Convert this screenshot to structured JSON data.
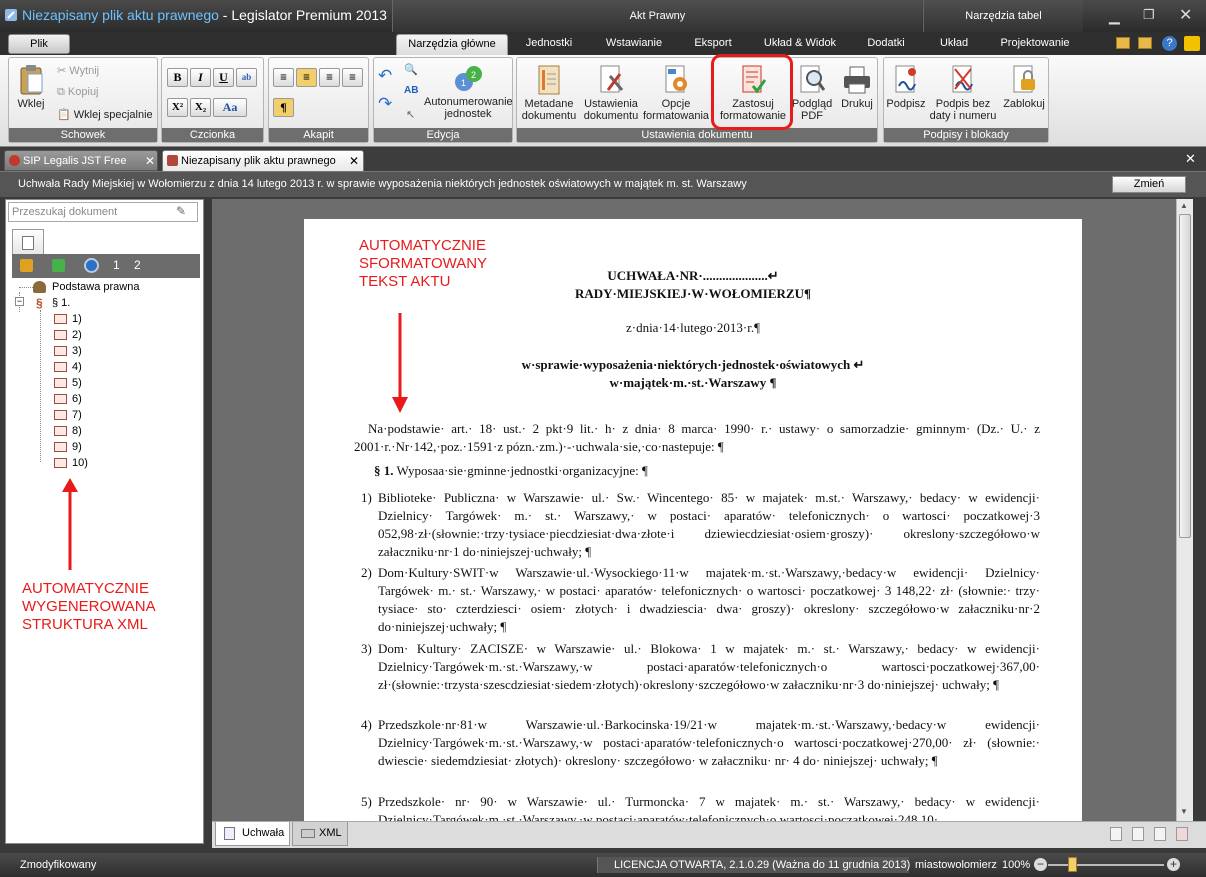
{
  "window": {
    "title_prefix": "Niezapisany plik aktu prawnego",
    "title_suffix": " - Legislator Premium 2013 ...",
    "contextual_group_1": "Akt Prawny",
    "contextual_group_2": "Narzędzia tabel"
  },
  "ribbon_tabs": {
    "file": "Plik",
    "home": "Narzędzia główne",
    "units": "Jednostki",
    "insert": "Wstawianie",
    "export": "Eksport",
    "layout_view": "Układ & Widok",
    "addins": "Dodatki",
    "table_layout": "Układ",
    "table_design": "Projektowanie"
  },
  "ribbon": {
    "clipboard": {
      "label": "Schowek",
      "paste": "Wklej",
      "cut": "Wytnij",
      "copy": "Kopiuj",
      "paste_special": "Wklej specjalnie"
    },
    "font": {
      "label": "Czcionka",
      "bold": "B",
      "italic": "I",
      "underline": "U",
      "superscript": "X²",
      "subscript": "X₂",
      "case": "Aa"
    },
    "paragraph": {
      "label": "Akapit",
      "pilcrow": "¶"
    },
    "edit": {
      "label": "Edycja",
      "autonumber": "Autonumerowanie jednostek"
    },
    "doc_settings": {
      "label": "Ustawienia dokumentu",
      "metadata": "Metadane dokumentu",
      "settings": "Ustawienia dokumentu",
      "format_options": "Opcje formatowania",
      "apply_format": "Zastosuj formatowanie",
      "pdf_preview": "Podgląd PDF",
      "print": "Drukuj"
    },
    "signatures": {
      "label": "Podpisy i blokady",
      "sign": "Podpisz",
      "sign_nodate": "Podpis bez daty i numeru",
      "lock": "Zablokuj"
    }
  },
  "doc_tabs": {
    "tab1": "SIP Legalis JST Free",
    "tab2": "Niezapisany plik aktu prawnego"
  },
  "info_bar": {
    "text": "Uchwała Rady Miejskiej w Wołomierzu z dnia 14 lutego 2013 r. w sprawie wyposażenia niektórych jednostek oświatowych  w majątek m. st. Warszawy",
    "change_button": "Zmień"
  },
  "left_pane": {
    "search_placeholder": "Przeszukaj dokument",
    "toolbar_level1": "1",
    "toolbar_level2": "2",
    "tree": {
      "legal_basis": "Podstawa prawna",
      "section": "§ 1.",
      "items": [
        "1)",
        "2)",
        "3)",
        "4)",
        "5)",
        "6)",
        "7)",
        "8)",
        "9)",
        "10)"
      ]
    }
  },
  "annotations": {
    "top_l1": "AUTOMATYCZNIE",
    "top_l2": "SFORMATOWANY",
    "top_l3": "TEKST AKTU",
    "bottom_l1": "AUTOMATYCZNIE",
    "bottom_l2": "WYGENEROWANA",
    "bottom_l3": "STRUKTURA XML"
  },
  "document": {
    "heading1": "UCHWAŁA·NR·....................↵",
    "heading2": "RADY·MIEJSKIEJ·W·WOŁOMIERZU¶",
    "date": "z·dnia·14·lutego·2013·r.¶",
    "subject1": "w·sprawie·wyposażenia·niektórych·jednostek·oświatowych ↵",
    "subject2": "w·majątek·m.·st.·Warszawy ¶",
    "intro": "Na·podstawie· art.· 18· ust.· 2 pkt·9 lit.· h· z dnia· 8 marca· 1990· r.· ustawy· o samorzadzie· gminnym· (Dz.· U.· z 2001·r.·Nr·142,·poz.·1591·z pózn.·zm.)·-·uchwala·sie,·co·nastepuje: ¶",
    "section_num": "§ 1.",
    "section_text": " Wyposaa·sie·gminne·jednostki·organizacyjne: ¶",
    "points": [
      {
        "n": "1)",
        "t": "Biblioteke· Publiczna· w Warszawie· ul.· Sw.· Wincentego· 85· w majatek· m.st.· Warszawy,· bedacy· w ewidencji· Dzielnicy· Targówek· m.· st.· Warszawy,· w postaci· aparatów· telefonicznych· o wartosci· poczatkowej·3 052,98·zł·(słownie:·trzy·tysiace·piecdziesiat·dwa·złote·i dziewiecdziesiat·osiem·groszy)· okreslony·szczegółowo·w załaczniku·nr·1 do·niniejszej·uchwały; ¶"
      },
      {
        "n": "2)",
        "t": "Dom·Kultury·SWIT·w Warszawie·ul.·Wysockiego·11·w majatek·m.·st.·Warszawy,·bedacy·w ewidencji· Dzielnicy· Targówek· m.· st.· Warszawy,· w postaci· aparatów· telefonicznych· o wartosci· poczatkowej· 3 148,22· zł· (słownie:· trzy· tysiace· sto· czterdziesci· osiem· złotych· i dwadziescia· dwa· groszy)· okreslony· szczegółowo·w załaczniku·nr·2 do·niniejszej·uchwały; ¶"
      },
      {
        "n": "3)",
        "t": "Dom· Kultury· ZACISZE· w Warszawie· ul.· Blokowa· 1 w majatek· m.· st.· Warszawy,· bedacy· w ewidencji· Dzielnicy·Targówek·m.·st.·Warszawy,·w postaci·aparatów·telefonicznych·o wartosci·poczatkowej·367,00· zł·(słownie:·trzysta·szescdziesiat·siedem·złotych)·okreslony·szczegółowo·w załaczniku·nr·3 do·niniejszej· uchwały; ¶"
      },
      {
        "n": "4)",
        "t": "Przedszkole·nr·81·w Warszawie·ul.·Barkocinska·19/21·w majatek·m.·st.·Warszawy,·bedacy·w ewidencji· Dzielnicy·Targówek·m.·st.·Warszawy,·w postaci·aparatów·telefonicznych·o wartosci·poczatkowej·270,00· zł· (słownie:· dwiescie· siedemdziesiat· złotych)· okreslony· szczegółowo· w załaczniku· nr· 4 do· niniejszej· uchwały; ¶"
      },
      {
        "n": "5)",
        "t": "Przedszkole· nr· 90· w Warszawie· ul.· Turmoncka· 7 w majatek· m.· st.· Warszawy,· bedacy· w ewidencji· Dzielnicy·Targówek·m.·st.·Warszawy,·w postaci·aparatów·telefonicznych·o wartosci·poczatkowej·248,10·"
      }
    ]
  },
  "bottom_tabs": {
    "uchwala": "Uchwała",
    "xml": "XML"
  },
  "status": {
    "modified": "Zmodyfikowany",
    "license": "LICENCJA OTWARTA, 2.1.0.29 (Ważna do 11 grudnia 2013)",
    "user": "miastowolomierz",
    "zoom": "100%"
  },
  "colors": {
    "annotation": "#e81a1a",
    "link_blue": "#6cc3ff"
  }
}
